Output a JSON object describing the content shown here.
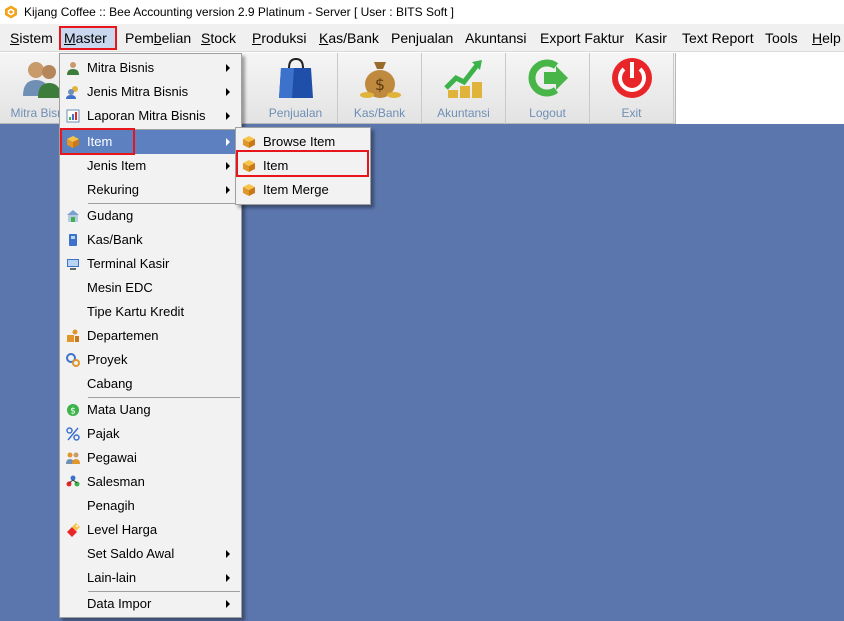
{
  "window": {
    "title": "Kijang Coffee :: Bee Accounting version 2.9 Platinum - Server  [ User : BITS Soft ]",
    "icon": "bee-logo-icon"
  },
  "menubar": {
    "items": [
      {
        "pre": "",
        "u": "S",
        "post": "istem"
      },
      {
        "pre": "",
        "u": "M",
        "post": "aster"
      },
      {
        "pre": "Pem",
        "u": "b",
        "post": "elian"
      },
      {
        "pre": "",
        "u": "S",
        "post": "tock"
      },
      {
        "pre": "",
        "u": "P",
        "post": "roduksi"
      },
      {
        "pre": "",
        "u": "K",
        "post": "as/Bank"
      },
      {
        "pre": "Pen",
        "u": "j",
        "post": "ualan"
      },
      {
        "pre": "",
        "u": "",
        "post": "Akuntansi"
      },
      {
        "pre": "",
        "u": "",
        "post": "Export Faktur"
      },
      {
        "pre": "",
        "u": "",
        "post": "Kasir"
      },
      {
        "pre": "",
        "u": "",
        "post": "Text Report"
      },
      {
        "pre": "",
        "u": "",
        "post": "Tools"
      },
      {
        "pre": "",
        "u": "H",
        "post": "elp"
      }
    ]
  },
  "toolbar": {
    "items": [
      {
        "label": "Mitra Bisnis",
        "icon": "users-icon"
      },
      {
        "label": "Penjualan",
        "icon": "shopping-bag-icon"
      },
      {
        "label": "Kas/Bank",
        "icon": "money-bag-icon"
      },
      {
        "label": "Akuntansi",
        "icon": "chart-coins-icon"
      },
      {
        "label": "Logout",
        "icon": "logout-icon"
      },
      {
        "label": "Exit",
        "icon": "power-icon"
      }
    ]
  },
  "master_menu": {
    "items": [
      {
        "label": "Mitra Bisnis",
        "icon": "person-icon",
        "submenu": true
      },
      {
        "label": "Jenis Mitra Bisnis",
        "icon": "people-icon",
        "submenu": true
      },
      {
        "label": "Laporan Mitra Bisnis",
        "icon": "report-icon",
        "submenu": true
      },
      {
        "label": "Item",
        "icon": "item-box-icon",
        "submenu": true,
        "highlighted": true
      },
      {
        "label": "Jenis Item",
        "icon": "",
        "submenu": true
      },
      {
        "label": "Rekuring",
        "icon": "",
        "submenu": true
      },
      {
        "label": "Gudang",
        "icon": "warehouse-icon",
        "submenu": false
      },
      {
        "label": "Kas/Bank",
        "icon": "bank-icon",
        "submenu": false
      },
      {
        "label": "Terminal Kasir",
        "icon": "terminal-icon",
        "submenu": false
      },
      {
        "label": "Mesin EDC",
        "icon": "",
        "submenu": false
      },
      {
        "label": "Tipe Kartu Kredit",
        "icon": "",
        "submenu": false
      },
      {
        "label": "Departemen",
        "icon": "department-icon",
        "submenu": false
      },
      {
        "label": "Proyek",
        "icon": "project-icon",
        "submenu": false
      },
      {
        "label": "Cabang",
        "icon": "",
        "submenu": false
      },
      {
        "label": "Mata Uang",
        "icon": "currency-icon",
        "submenu": false
      },
      {
        "label": "Pajak",
        "icon": "percent-icon",
        "submenu": false
      },
      {
        "label": "Pegawai",
        "icon": "employee-icon",
        "submenu": false
      },
      {
        "label": "Salesman",
        "icon": "salesman-icon",
        "submenu": false
      },
      {
        "label": "Penagih",
        "icon": "",
        "submenu": false
      },
      {
        "label": "Level Harga",
        "icon": "price-level-icon",
        "submenu": false
      },
      {
        "label": "Set Saldo Awal",
        "icon": "",
        "submenu": true
      },
      {
        "label": "Lain-lain",
        "icon": "",
        "submenu": true
      },
      {
        "label": "Data Impor",
        "icon": "",
        "submenu": true
      }
    ]
  },
  "item_submenu": {
    "items": [
      {
        "label": "Browse Item",
        "icon": "item-box-icon"
      },
      {
        "label": "Item",
        "icon": "item-box-icon",
        "marked": true
      },
      {
        "label": "Item Merge",
        "icon": "item-box-icon"
      }
    ]
  },
  "colors": {
    "workspace": "#5a76ac",
    "highlight": "#5c80c0",
    "annotation": "#e8161a",
    "toolbar_label": "#6f8fb5"
  }
}
